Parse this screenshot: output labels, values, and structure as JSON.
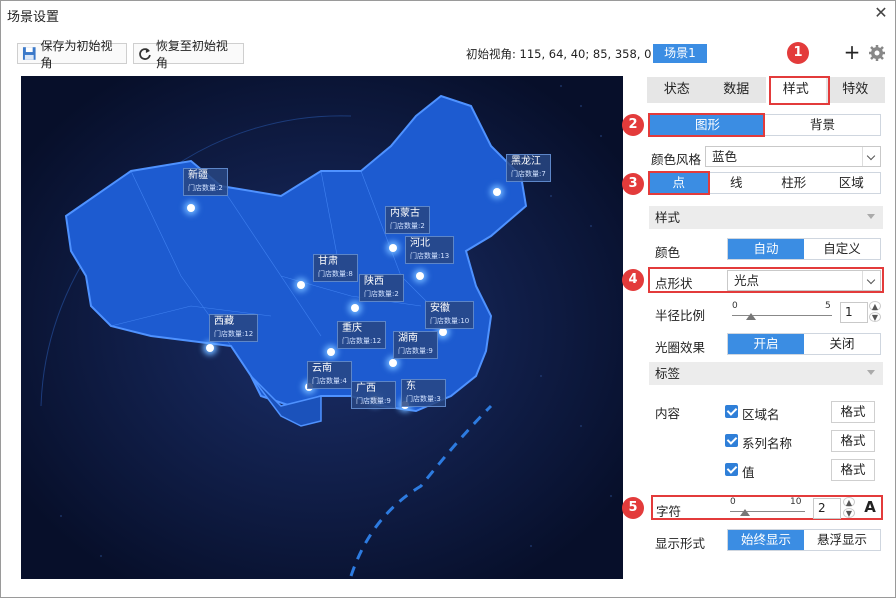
{
  "window": {
    "title": "场景设置",
    "close": "✕"
  },
  "toolbar": {
    "save_label": "保存为初始视角",
    "restore_label": "恢复至初始视角",
    "initial_view": "初始视角: 115, 64, 40; 85, 358, 0",
    "scene_badge": "场景1"
  },
  "tabs": [
    "状态",
    "数据",
    "样式",
    "特效"
  ],
  "panel": {
    "graph_bg": [
      "图形",
      "背景"
    ],
    "color_style_label": "颜色风格",
    "color_style_value": "蓝色",
    "shape_types": [
      "点",
      "线",
      "柱形",
      "区域"
    ],
    "style_section": "样式",
    "color_label": "颜色",
    "color_opts": [
      "自动",
      "自定义"
    ],
    "point_shape_label": "点形状",
    "point_shape_value": "光点",
    "radius_label": "半径比例",
    "radius_min": "0",
    "radius_max": "5",
    "radius_value": "1",
    "halo_label": "光圈效果",
    "halo_opts": [
      "开启",
      "关闭"
    ],
    "tag_section": "标签",
    "content_label": "内容",
    "content_items": [
      {
        "label": "区域名",
        "format": "格式"
      },
      {
        "label": "系列名称",
        "format": "格式"
      },
      {
        "label": "值",
        "format": "格式"
      }
    ],
    "char_label": "字符",
    "char_min": "0",
    "char_max": "10",
    "char_value": "2",
    "font_btn": "A",
    "display_label": "显示形式",
    "display_opts": [
      "始终显示",
      "悬浮显示"
    ]
  },
  "badges": [
    "1",
    "2",
    "3",
    "4",
    "5"
  ],
  "map": {
    "provinces": [
      {
        "name": "新疆",
        "sub": "门店数量:2"
      },
      {
        "name": "黑龙江",
        "sub": "门店数量:7"
      },
      {
        "name": "内蒙古",
        "sub": "门店数量:2"
      },
      {
        "name": "河北",
        "sub": "门店数量:13"
      },
      {
        "name": "甘肃",
        "sub": "门店数量:8"
      },
      {
        "name": "陕西",
        "sub": "门店数量:2"
      },
      {
        "name": "西藏",
        "sub": "门店数量:12"
      },
      {
        "name": "安徽",
        "sub": "门店数量:10"
      },
      {
        "name": "重庆",
        "sub": "门店数量:12"
      },
      {
        "name": "湖南",
        "sub": "门店数量:9"
      },
      {
        "name": "云南",
        "sub": "门店数量:4"
      },
      {
        "name": "广西",
        "sub": "门店数量:9"
      },
      {
        "name": "东",
        "sub": "门店数量:3"
      }
    ]
  },
  "colors": {
    "accent": "#3b8de3",
    "badge": "#e33b3b",
    "map_bg": "#0a1434",
    "china": "#1d5bd0"
  }
}
